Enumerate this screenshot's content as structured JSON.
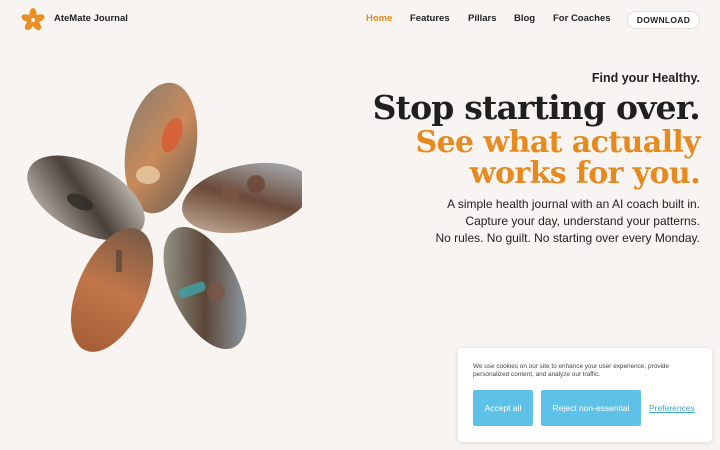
{
  "header": {
    "brand": "AteMate Journal",
    "nav": [
      {
        "label": "Home",
        "active": true
      },
      {
        "label": "Features",
        "active": false
      },
      {
        "label": "Pillars",
        "active": false
      },
      {
        "label": "Blog",
        "active": false
      },
      {
        "label": "For Coaches",
        "active": false
      }
    ],
    "download_label": "DOWNLOAD"
  },
  "hero": {
    "eyebrow": "Find your Healthy.",
    "headline": "Stop starting over.",
    "subheadline": "See what actually works for you.",
    "body_lines": [
      "A simple health journal with an AI coach built in.",
      "Capture your day, understand your patterns.",
      "No rules. No guilt. No starting over every Monday."
    ]
  },
  "cookie": {
    "text": "We use cookies on our site to enhance your user experience, provide personalized content, and analyze our traffic.",
    "accept_label": "Accept all",
    "reject_label": "Reject non-essential",
    "preferences_label": "Preferences"
  },
  "colors": {
    "accent": "#e68a1f",
    "background": "#f7f4f1",
    "cookie_button": "#5ec1e7"
  }
}
